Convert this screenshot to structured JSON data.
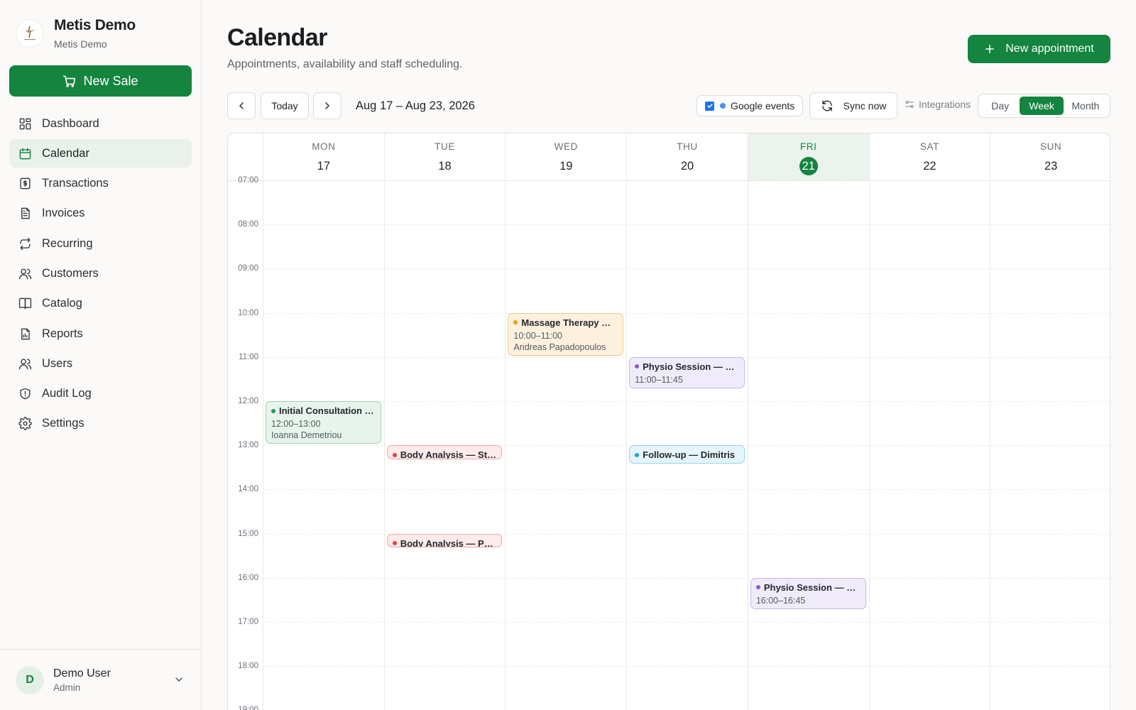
{
  "brand": {
    "name": "Metis Demo",
    "subtitle": "Metis Demo"
  },
  "sidebar": {
    "new_sale_label": "New Sale",
    "items": [
      {
        "label": "Dashboard",
        "icon": "dashboard-icon",
        "active": false
      },
      {
        "label": "Calendar",
        "icon": "calendar-icon",
        "active": true
      },
      {
        "label": "Transactions",
        "icon": "transactions-icon",
        "active": false
      },
      {
        "label": "Invoices",
        "icon": "invoice-icon",
        "active": false
      },
      {
        "label": "Recurring",
        "icon": "recurring-icon",
        "active": false
      },
      {
        "label": "Customers",
        "icon": "customers-icon",
        "active": false
      },
      {
        "label": "Catalog",
        "icon": "catalog-icon",
        "active": false
      },
      {
        "label": "Reports",
        "icon": "reports-icon",
        "active": false
      },
      {
        "label": "Users",
        "icon": "users-icon",
        "active": false
      },
      {
        "label": "Audit Log",
        "icon": "shield-icon",
        "active": false
      },
      {
        "label": "Settings",
        "icon": "gear-icon",
        "active": false
      }
    ],
    "user": {
      "initial": "D",
      "name": "Demo User",
      "role": "Admin"
    }
  },
  "header": {
    "title": "Calendar",
    "subtitle": "Appointments, availability and staff scheduling.",
    "new_appointment_label": "New appointment"
  },
  "toolbar": {
    "today_label": "Today",
    "range_label": "Aug 17 – Aug 23, 2026",
    "google_events_label": "Google events",
    "google_events_checked": true,
    "sync_label": "Sync now",
    "integrations_label": "Integrations",
    "views": [
      "Day",
      "Week",
      "Month"
    ],
    "active_view": "Week"
  },
  "calendar": {
    "days": [
      {
        "name": "MON",
        "num": "17",
        "today": false
      },
      {
        "name": "TUE",
        "num": "18",
        "today": false
      },
      {
        "name": "WED",
        "num": "19",
        "today": false
      },
      {
        "name": "THU",
        "num": "20",
        "today": false
      },
      {
        "name": "FRI",
        "num": "21",
        "today": true
      },
      {
        "name": "SAT",
        "num": "22",
        "today": false
      },
      {
        "name": "SUN",
        "num": "23",
        "today": false
      }
    ],
    "hours": [
      "07:00",
      "08:00",
      "09:00",
      "10:00",
      "11:00",
      "12:00",
      "13:00",
      "14:00",
      "15:00",
      "16:00",
      "17:00",
      "18:00",
      "19:00"
    ],
    "events": [
      {
        "day": 0,
        "start": 12,
        "end": 13,
        "title": "Initial Consultation — Ioanna Demetriou",
        "time": "12:00–13:00",
        "person": "Ioanna Demetriou",
        "bg": "#e7f4ec",
        "border": "#9fd3b2",
        "dot": "#1f9b54"
      },
      {
        "day": 1,
        "start": 13,
        "end": 13.35,
        "title": "Body Analysis — Stavros",
        "time": "",
        "person": "",
        "bg": "#fcebea",
        "border": "#f0a8a4",
        "dot": "#e0453c"
      },
      {
        "day": 1,
        "start": 15,
        "end": 15.35,
        "title": "Body Analysis — Panagiota",
        "time": "",
        "person": "",
        "bg": "#fcebea",
        "border": "#f0a8a4",
        "dot": "#e0453c"
      },
      {
        "day": 2,
        "start": 10,
        "end": 11,
        "title": "Massage Therapy — Andreas Papadopoulos",
        "time": "10:00–11:00",
        "person": "Andreas Papadopoulos",
        "bg": "#fdf1de",
        "border": "#f2c88a",
        "dot": "#f29a12"
      },
      {
        "day": 3,
        "start": 11,
        "end": 11.75,
        "title": "Physio Session — Maria",
        "time": "11:00–11:45",
        "person": "",
        "bg": "#f0ebfb",
        "border": "#c6b4ee",
        "dot": "#8a5ad6"
      },
      {
        "day": 3,
        "start": 13,
        "end": 13.45,
        "title": "Follow-up — Dimitris",
        "time": "",
        "person": "",
        "bg": "#e6f5fb",
        "border": "#93d2ea",
        "dot": "#1aa6d6"
      },
      {
        "day": 4,
        "start": 16,
        "end": 16.75,
        "title": "Physio Session — Maria",
        "time": "16:00–16:45",
        "person": "",
        "bg": "#f0ebfb",
        "border": "#c6b4ee",
        "dot": "#8a5ad6"
      }
    ]
  },
  "colors": {
    "accent": "#14843f",
    "google": "#4c8df6"
  }
}
